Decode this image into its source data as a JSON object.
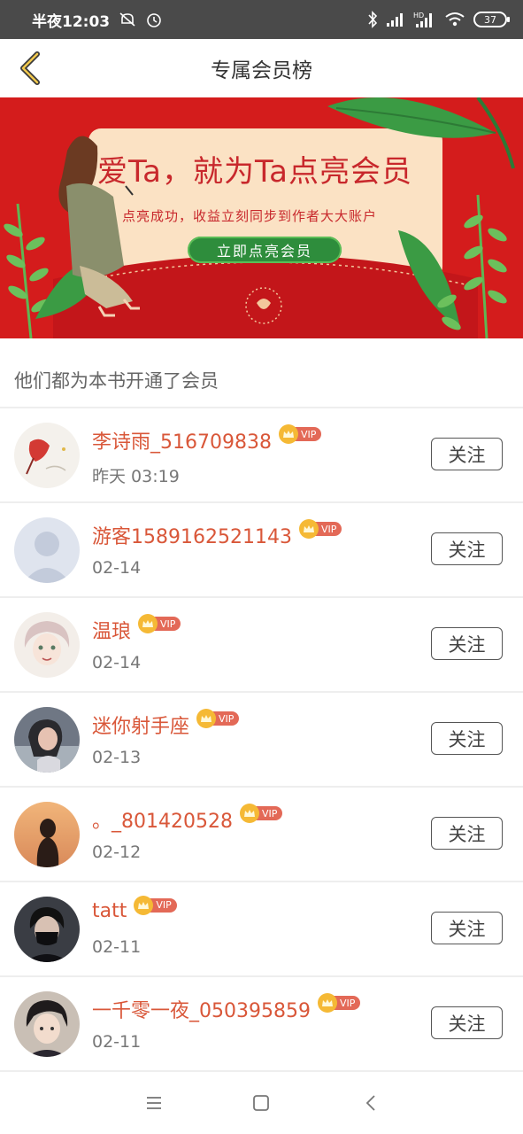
{
  "status_bar": {
    "time": "半夜12:03",
    "battery": "37",
    "network_label": "HD"
  },
  "header": {
    "title": "专属会员榜"
  },
  "banner": {
    "headline": "爱Ta，就为Ta点亮会员",
    "subtitle": "点亮成功，收益立刻同步到作者大大账户",
    "cta": "立即点亮会员"
  },
  "section": {
    "title": "他们都为本书开通了会员"
  },
  "vip_label": "VIP",
  "follow_label": "关注",
  "members": [
    {
      "name": "李诗雨_516709838",
      "time": "昨天 03:19",
      "avatar": "red-umbrella-avatar"
    },
    {
      "name": "游客1589162521143",
      "time": "02-14",
      "avatar": "default-avatar"
    },
    {
      "name": "温琅",
      "time": "02-14",
      "avatar": "anime-avatar"
    },
    {
      "name": "迷你射手座",
      "time": "02-13",
      "avatar": "photo-avatar"
    },
    {
      "name": "。_801420528",
      "time": "02-12",
      "avatar": "sunset-avatar"
    },
    {
      "name": "tatt",
      "time": "02-11",
      "avatar": "masked-avatar"
    },
    {
      "name": "一千零一夜_050395859",
      "time": "02-11",
      "avatar": "anime-boy-avatar"
    }
  ],
  "colors": {
    "accent": "#d95739",
    "banner_red": "#d41c1c",
    "vip_gold": "#f5b935",
    "vip_tag": "#e36957"
  }
}
